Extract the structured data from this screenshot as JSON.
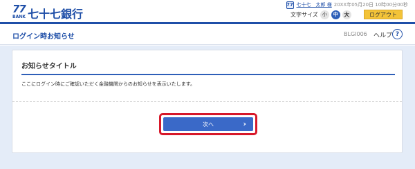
{
  "header": {
    "logo_mark": "77",
    "logo_bank": "BANK",
    "bank_name": "七十七銀行",
    "user_icon": "77",
    "user_name": "七十七　太郎 様",
    "last_login": "20XX年05月20日 10時00分00秒",
    "font_size_label": "文字サイズ",
    "size_small": "小",
    "size_medium": "中",
    "size_large": "大",
    "logout_label": "ログアウト"
  },
  "titlebar": {
    "page_title": "ログイン時お知らせ",
    "screen_id": "BLGI006",
    "help_label": "ヘルプ",
    "help_icon": "?"
  },
  "notice": {
    "title": "お知らせタイトル",
    "body": "ここにログイン時にご確認いただく金融機関からのお知らせを表示いたします。"
  },
  "actions": {
    "next_label": "次へ",
    "next_chevron": "›"
  },
  "colors": {
    "brand_blue": "#1f4fa8",
    "button_blue": "#3a69c8",
    "logout_yellow": "#f3c338",
    "highlight_red": "#d7182a",
    "background": "#e4ecf8"
  },
  "icons": {
    "user": "user-badge-icon",
    "help": "question-circle-icon",
    "next": "chevron-right-icon"
  }
}
